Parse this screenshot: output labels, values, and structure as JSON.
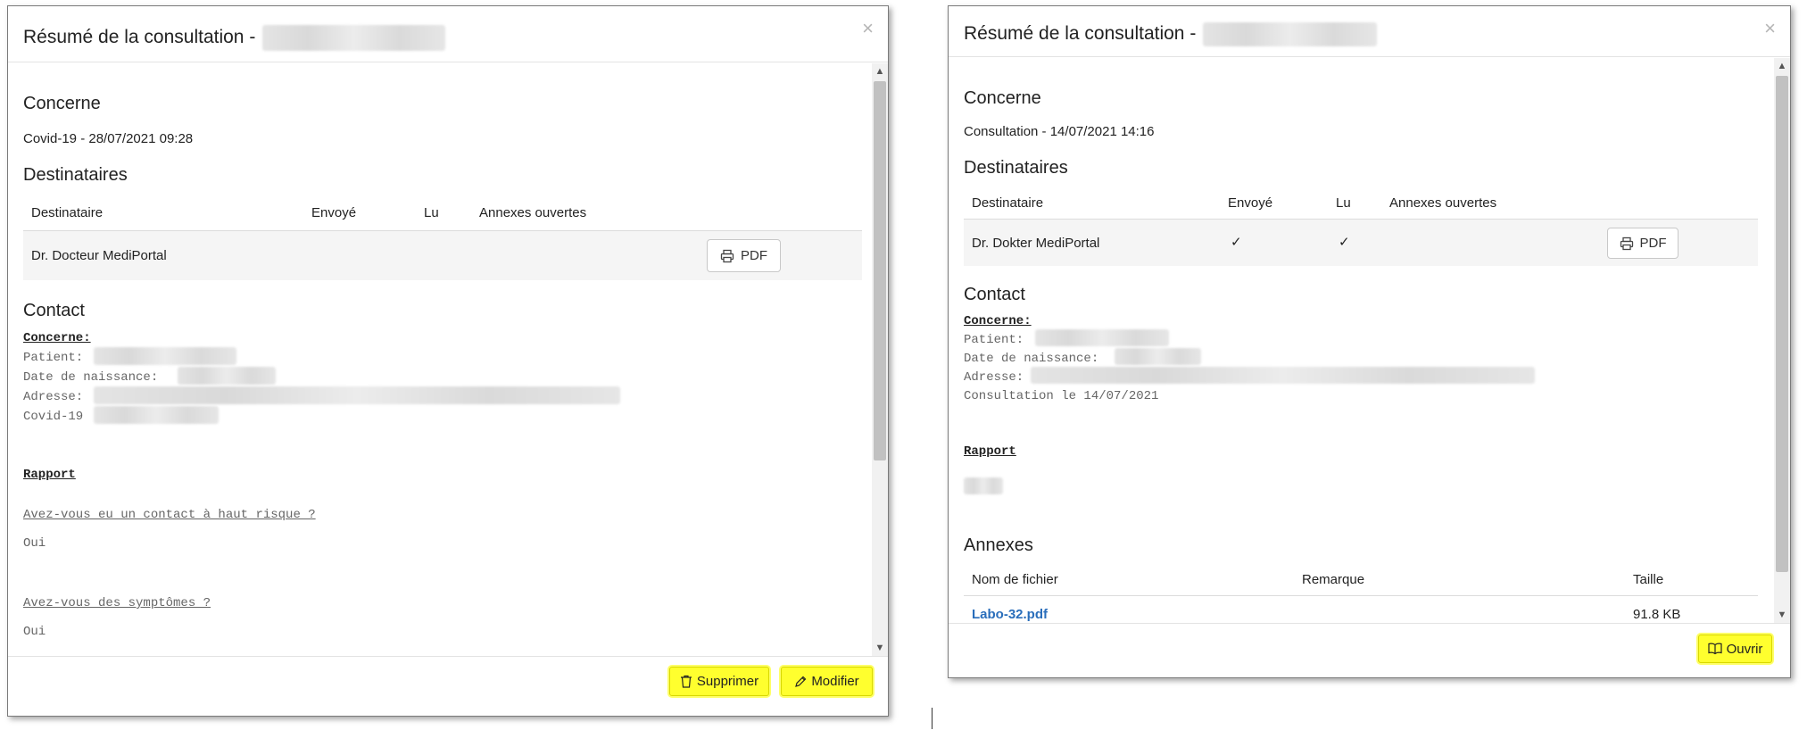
{
  "left": {
    "title": "Résumé de la consultation -",
    "close": "×",
    "concerne_heading": "Concerne",
    "concerne_value": "Covid-19 - 28/07/2021 09:28",
    "destinataires_heading": "Destinataires",
    "table_headers": [
      "Destinataire",
      "Envoyé",
      "Lu",
      "Annexes ouvertes"
    ],
    "row": {
      "destinataire": "Dr. Docteur MediPortal",
      "envoye": "",
      "lu": "",
      "pdf_label": "PDF"
    },
    "contact_heading": "Contact",
    "contact_concerne": "Concerne:",
    "patient_label": "Patient:",
    "dob_label": "Date de naissance:",
    "adresse_label": "Adresse:",
    "covid_label": "Covid-19",
    "rapport_label": "Rapport",
    "q1": "Avez-vous eu un contact à haut risque ?",
    "a1": "Oui",
    "q2": "Avez-vous des symptômes ?",
    "a2": "Oui",
    "btn_delete": "Supprimer",
    "btn_edit": "Modifier"
  },
  "right": {
    "title": "Résumé de la consultation -",
    "close": "×",
    "concerne_heading": "Concerne",
    "concerne_value": "Consultation - 14/07/2021 14:16",
    "destinataires_heading": "Destinataires",
    "table_headers": [
      "Destinataire",
      "Envoyé",
      "Lu",
      "Annexes ouvertes"
    ],
    "row": {
      "destinataire": "Dr. Dokter MediPortal",
      "envoye": "✓",
      "lu": "✓",
      "pdf_label": "PDF"
    },
    "contact_heading": "Contact",
    "contact_concerne": "Concerne:",
    "patient_label": "Patient:",
    "dob_label": "Date de naissance:",
    "adresse_label": "Adresse:",
    "consultation_line": "Consultation le 14/07/2021",
    "rapport_label": "Rapport",
    "annexes_heading": "Annexes",
    "annexes_headers": [
      "Nom de fichier",
      "Remarque",
      "Taille"
    ],
    "file": {
      "name": "Labo-32.pdf",
      "remarque": "",
      "taille": "91.8 KB"
    },
    "btn_open": "Ouvrir"
  },
  "colors": {
    "highlight_button": "#ffff2e",
    "link": "#2a6ebb"
  },
  "icons": [
    "printer-icon",
    "trash-icon",
    "pencil-icon",
    "book-icon"
  ]
}
